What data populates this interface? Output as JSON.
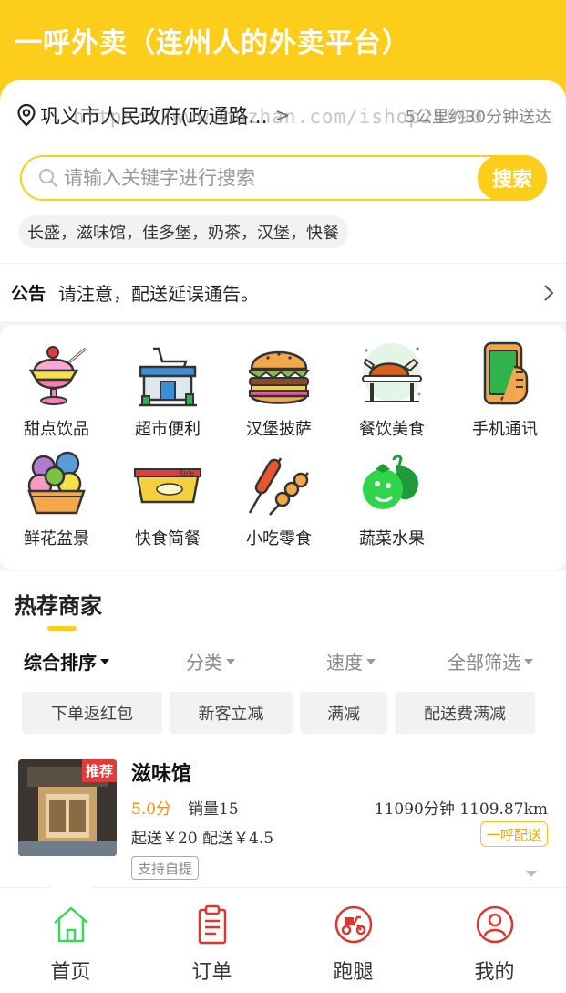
{
  "header": {
    "title": "一呼外卖（连州人的外卖平台）"
  },
  "location": {
    "address": "巩义市人民政府(政通路...",
    "arrow": ">",
    "delivery_info": "5公里约30分钟送达",
    "watermark": "https://www.huzhan.com/ishop26990"
  },
  "search": {
    "placeholder": "请输入关键字进行搜索",
    "button_label": "搜索",
    "hot_keywords": "长盛，滋味馆，佳多堡，奶茶，汉堡，快餐"
  },
  "notice": {
    "label": "公告",
    "text": "请注意，配送延误通告。"
  },
  "categories": [
    {
      "label": "甜点饮品",
      "icon": "dessert-icon"
    },
    {
      "label": "超市便利",
      "icon": "supermarket-icon"
    },
    {
      "label": "汉堡披萨",
      "icon": "burger-icon"
    },
    {
      "label": "餐饮美食",
      "icon": "roast-chicken-icon"
    },
    {
      "label": "手机通讯",
      "icon": "phone-icon"
    },
    {
      "label": "鲜花盆景",
      "icon": "flower-icon"
    },
    {
      "label": "快食简餐",
      "icon": "fast-food-icon"
    },
    {
      "label": "小吃零食",
      "icon": "snack-icon"
    },
    {
      "label": "蔬菜水果",
      "icon": "vegetable-icon"
    }
  ],
  "recommended": {
    "title": "热荐商家",
    "sort_options": [
      {
        "label": "综合排序",
        "active": true
      },
      {
        "label": "分类",
        "active": false
      },
      {
        "label": "速度",
        "active": false
      },
      {
        "label": "全部筛选",
        "active": false
      }
    ],
    "filters": [
      "下单返红包",
      "新客立减",
      "满减",
      "配送费满减"
    ],
    "shops": [
      {
        "badge": "推荐",
        "name": "滋味馆",
        "rating": "5.0分",
        "sales": "销量15",
        "time_distance": "11090分钟  1109.87km",
        "fee": "起送￥20   配送￥4.5",
        "delivery_tag": "一呼配送",
        "pickup_tag": "支持自提"
      }
    ]
  },
  "tabbar": [
    {
      "label": "首页",
      "active": true
    },
    {
      "label": "订单",
      "active": false
    },
    {
      "label": "跑腿",
      "active": false
    },
    {
      "label": "我的",
      "active": false
    }
  ],
  "colors": {
    "brand": "#fccd1b",
    "active_tab": "#3ad65b",
    "icon_red": "#d9372f"
  }
}
